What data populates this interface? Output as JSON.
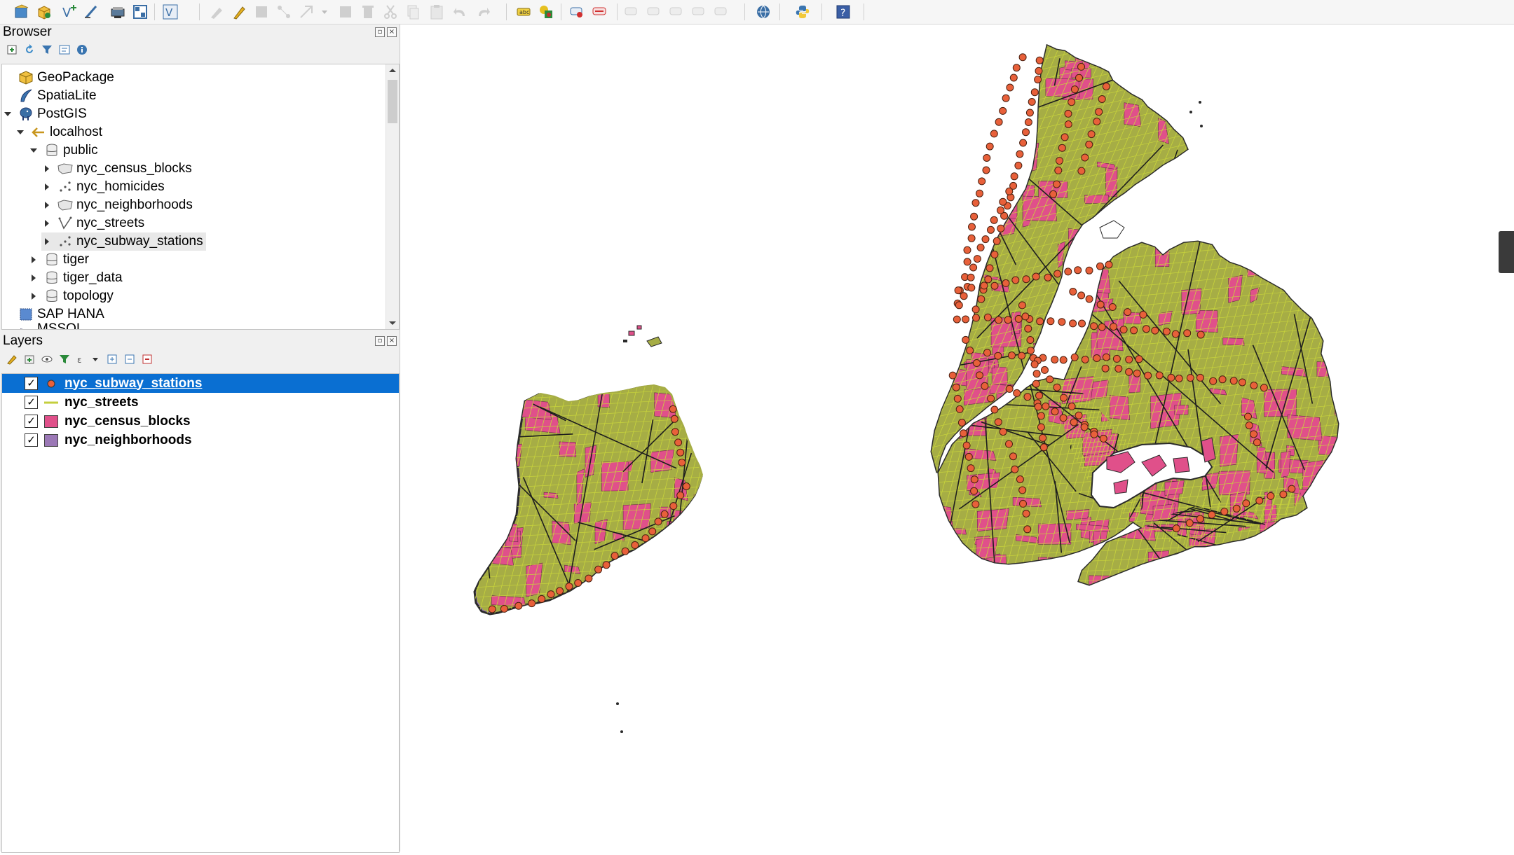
{
  "browser": {
    "title": "Browser",
    "items": [
      {
        "label": "GeoPackage"
      },
      {
        "label": "SpatiaLite"
      },
      {
        "label": "PostGIS"
      },
      {
        "label": "localhost"
      },
      {
        "label": "public"
      },
      {
        "label": "nyc_census_blocks"
      },
      {
        "label": "nyc_homicides"
      },
      {
        "label": "nyc_neighborhoods"
      },
      {
        "label": "nyc_streets"
      },
      {
        "label": "nyc_subway_stations"
      },
      {
        "label": "tiger"
      },
      {
        "label": "tiger_data"
      },
      {
        "label": "topology"
      },
      {
        "label": "SAP HANA"
      },
      {
        "label": "MSSQL"
      }
    ]
  },
  "layers": {
    "title": "Layers",
    "items": [
      {
        "label": "nyc_subway_stations",
        "checked": true,
        "selected": true,
        "symbol": "point",
        "color": "#e8603a"
      },
      {
        "label": "nyc_streets",
        "checked": true,
        "selected": false,
        "symbol": "line",
        "color": "#c4cf3e"
      },
      {
        "label": "nyc_census_blocks",
        "checked": true,
        "selected": false,
        "symbol": "polygon",
        "color": "#e0508a"
      },
      {
        "label": "nyc_neighborhoods",
        "checked": true,
        "selected": false,
        "symbol": "polygon",
        "color": "#9b78b6"
      }
    ]
  },
  "map": {
    "colors": {
      "land": "#a6ad45",
      "blocks": "#e0508a",
      "streets": "#c8d43c",
      "stations": "#e8603a",
      "neighborhoods": "#9b78b6",
      "outline": "#2a2a2a"
    }
  },
  "icons": {
    "toolbar": [
      "new-project-icon",
      "open-project-icon",
      "new-vector-icon",
      "digitize-icon",
      "save-icon",
      "layout-icon",
      "vector-check-icon",
      "edit-icon",
      "pencil-icon",
      "save-edits-icon",
      "node-tool-icon",
      "delete-icon",
      "cut-icon",
      "copy-icon",
      "paste-icon",
      "undo-icon",
      "redo-icon",
      "label-icon",
      "style-icon",
      "pin-icon",
      "label-toggle-icon",
      "python-icon",
      "help-icon"
    ]
  }
}
